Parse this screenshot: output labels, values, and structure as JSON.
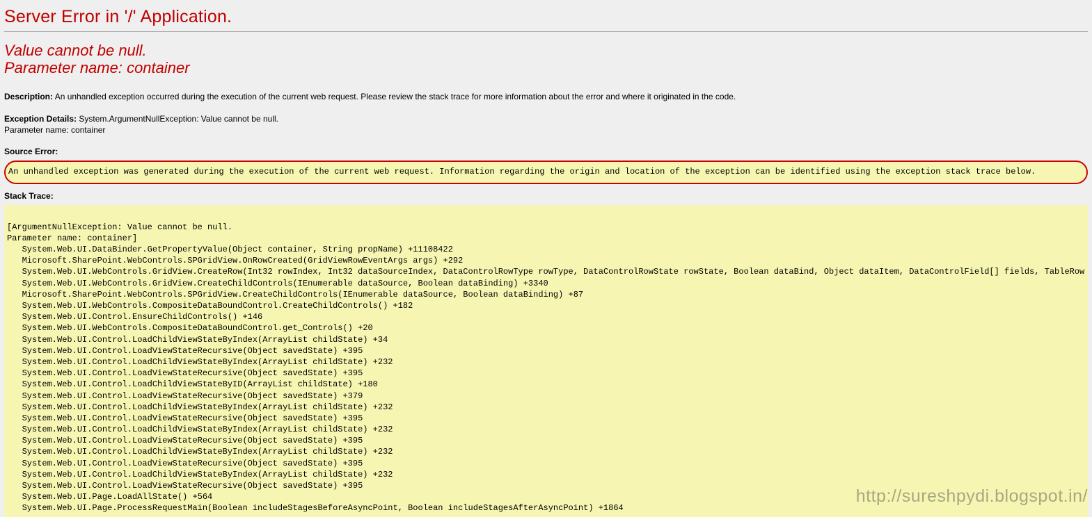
{
  "error": {
    "title": "Server Error in '/' Application.",
    "subtitle": "Value cannot be null.\nParameter name: container",
    "description_label": "Description:",
    "description_text": "An unhandled exception occurred during the execution of the current web request. Please review the stack trace for more information about the error and where it originated in the code.",
    "exception_label": "Exception Details:",
    "exception_text": "System.ArgumentNullException: Value cannot be null.\nParameter name: container",
    "source_error_label": "Source Error:",
    "source_error_text": "An unhandled exception was generated during the execution of the current web request. Information regarding the origin and location of the exception can be identified using the exception stack trace below.",
    "stack_trace_label": "Stack Trace:",
    "stack_trace_text": "\n[ArgumentNullException: Value cannot be null.\nParameter name: container]\n   System.Web.UI.DataBinder.GetPropertyValue(Object container, String propName) +11108422\n   Microsoft.SharePoint.WebControls.SPGridView.OnRowCreated(GridViewRowEventArgs args) +292\n   System.Web.UI.WebControls.GridView.CreateRow(Int32 rowIndex, Int32 dataSourceIndex, DataControlRowType rowType, DataControlRowState rowState, Boolean dataBind, Object dataItem, DataControlField[] fields, TableRowCollecti\n   System.Web.UI.WebControls.GridView.CreateChildControls(IEnumerable dataSource, Boolean dataBinding) +3340\n   Microsoft.SharePoint.WebControls.SPGridView.CreateChildControls(IEnumerable dataSource, Boolean dataBinding) +87\n   System.Web.UI.WebControls.CompositeDataBoundControl.CreateChildControls() +182\n   System.Web.UI.Control.EnsureChildControls() +146\n   System.Web.UI.WebControls.CompositeDataBoundControl.get_Controls() +20\n   System.Web.UI.Control.LoadChildViewStateByIndex(ArrayList childState) +34\n   System.Web.UI.Control.LoadViewStateRecursive(Object savedState) +395\n   System.Web.UI.Control.LoadChildViewStateByIndex(ArrayList childState) +232\n   System.Web.UI.Control.LoadViewStateRecursive(Object savedState) +395\n   System.Web.UI.Control.LoadChildViewStateByID(ArrayList childState) +180\n   System.Web.UI.Control.LoadViewStateRecursive(Object savedState) +379\n   System.Web.UI.Control.LoadChildViewStateByIndex(ArrayList childState) +232\n   System.Web.UI.Control.LoadViewStateRecursive(Object savedState) +395\n   System.Web.UI.Control.LoadChildViewStateByIndex(ArrayList childState) +232\n   System.Web.UI.Control.LoadViewStateRecursive(Object savedState) +395\n   System.Web.UI.Control.LoadChildViewStateByIndex(ArrayList childState) +232\n   System.Web.UI.Control.LoadViewStateRecursive(Object savedState) +395\n   System.Web.UI.Control.LoadChildViewStateByIndex(ArrayList childState) +232\n   System.Web.UI.Control.LoadViewStateRecursive(Object savedState) +395\n   System.Web.UI.Page.LoadAllState() +564\n   System.Web.UI.Page.ProcessRequestMain(Boolean includeStagesBeforeAsyncPoint, Boolean includeStagesAfterAsyncPoint) +1864"
  },
  "watermark": "http://sureshpydi.blogspot.in/"
}
